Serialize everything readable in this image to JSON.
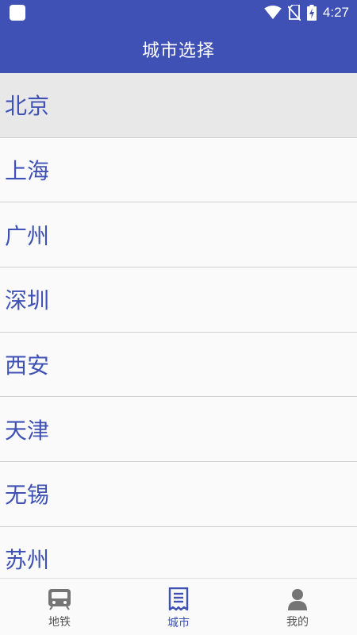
{
  "status_bar": {
    "time": "4:27",
    "icons": [
      "app-icon",
      "wifi-icon",
      "no-sim-icon",
      "battery-charging-icon"
    ]
  },
  "app_bar": {
    "title": "城市选择"
  },
  "city_list": {
    "selected_index": 0,
    "items": [
      {
        "label": "北京"
      },
      {
        "label": "上海"
      },
      {
        "label": "广州"
      },
      {
        "label": "深圳"
      },
      {
        "label": "西安"
      },
      {
        "label": "天津"
      },
      {
        "label": "无锡"
      },
      {
        "label": "苏州"
      }
    ]
  },
  "bottom_nav": {
    "active_index": 1,
    "tabs": [
      {
        "label": "地铁",
        "icon": "train-icon"
      },
      {
        "label": "城市",
        "icon": "receipt-list-icon"
      },
      {
        "label": "我的",
        "icon": "person-icon"
      }
    ]
  },
  "colors": {
    "primary": "#3f51b5",
    "selected_row": "#e8e8e8",
    "inactive_icon": "#757575"
  }
}
